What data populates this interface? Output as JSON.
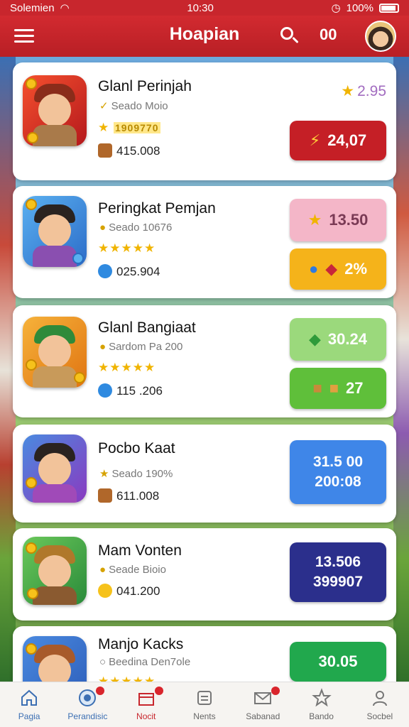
{
  "status_bar": {
    "carrier": "Solemien",
    "time": "10:30",
    "battery": "100%"
  },
  "app_bar": {
    "title": "Hoapian",
    "count": "00"
  },
  "games": [
    {
      "title": "Glanl Perinjah",
      "subtitle": "Seado Moio",
      "stars_text": "1909770",
      "stat": "415.008",
      "rating": "2.95",
      "buttons": [
        {
          "text": "24,07",
          "color": "#c51f26"
        }
      ]
    },
    {
      "title": "Peringkat Pemjan",
      "subtitle": "Seado 10676",
      "stars": "★★★★★",
      "stat": "025.904",
      "buttons": [
        {
          "text": "13.50",
          "color": "#f4b6c8",
          "text_color": "#7a3a55"
        },
        {
          "text": "2%",
          "color": "#f5b31a"
        }
      ]
    },
    {
      "title": "Glanl Bangiaat",
      "subtitle": "Sardom Pa 200",
      "stars": "★★★★★",
      "stat": "115 .206",
      "buttons": [
        {
          "text": "30.24",
          "color": "#9bd97c"
        },
        {
          "text": "27",
          "color": "#5fbf3a"
        }
      ]
    },
    {
      "title": "Pocbo Kaat",
      "subtitle": "Seado 190%",
      "stat": "611.008",
      "buttons": [
        {
          "lines": [
            "31.5 00",
            "200:08"
          ],
          "color": "#3f86e8"
        }
      ]
    },
    {
      "title": "Mam Vonten",
      "subtitle": "Seade Bioio",
      "stat": "041.200",
      "buttons": [
        {
          "lines": [
            "13.506",
            "399907"
          ],
          "color": "#2b2f8c"
        }
      ]
    },
    {
      "title": "Manjo Kacks",
      "subtitle": "Beedina Den7ole",
      "stars": "★★★★★",
      "buttons": [
        {
          "text": "30.05",
          "color": "#21a84d"
        }
      ]
    }
  ],
  "bottom_nav": [
    {
      "label": "Pagia",
      "icon": "home-icon",
      "badge": false
    },
    {
      "label": "Perandisic",
      "icon": "chat-icon",
      "badge": true
    },
    {
      "label": "Nocit",
      "icon": "gift-icon",
      "badge": true
    },
    {
      "label": "Nents",
      "icon": "inbox-icon",
      "badge": false
    },
    {
      "label": "Sabanad",
      "icon": "mail-icon",
      "badge": true
    },
    {
      "label": "Bando",
      "icon": "star-icon",
      "badge": false
    },
    {
      "label": "Socbel",
      "icon": "profile-icon",
      "badge": false
    }
  ]
}
